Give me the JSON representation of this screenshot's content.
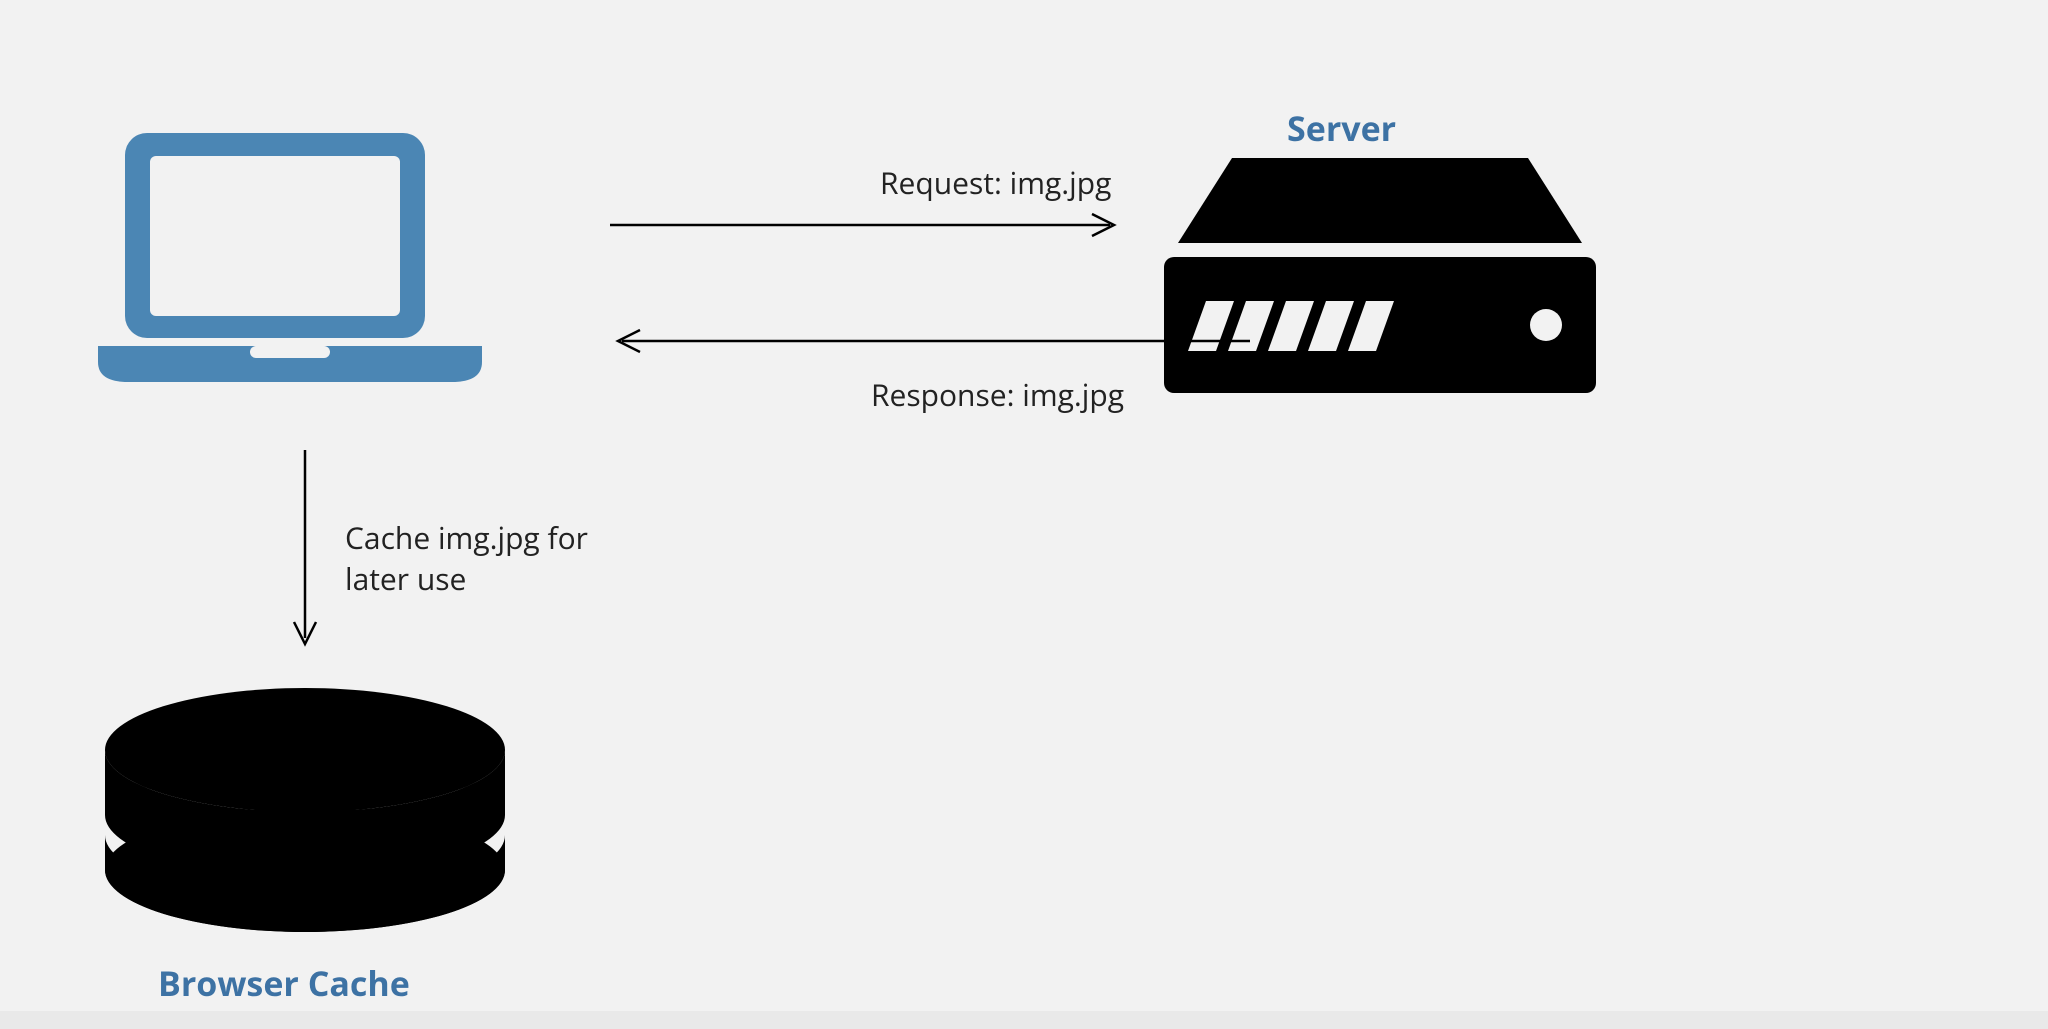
{
  "labels": {
    "server": "Server",
    "request": "Request: img.jpg",
    "response": "Response: img.jpg",
    "cache_note": "Cache img.jpg for\nlater use",
    "browser_cache": "Browser Cache"
  },
  "nodes": {
    "client": "laptop",
    "server": "server",
    "cache": "browser-cache"
  },
  "flows": [
    {
      "from": "client",
      "to": "server",
      "label_key": "request"
    },
    {
      "from": "server",
      "to": "client",
      "label_key": "response"
    },
    {
      "from": "client",
      "to": "cache",
      "label_key": "cache_note"
    }
  ],
  "colors": {
    "accent_blue": "#3d72a4",
    "laptop_blue": "#4b86b4",
    "black": "#000000"
  }
}
